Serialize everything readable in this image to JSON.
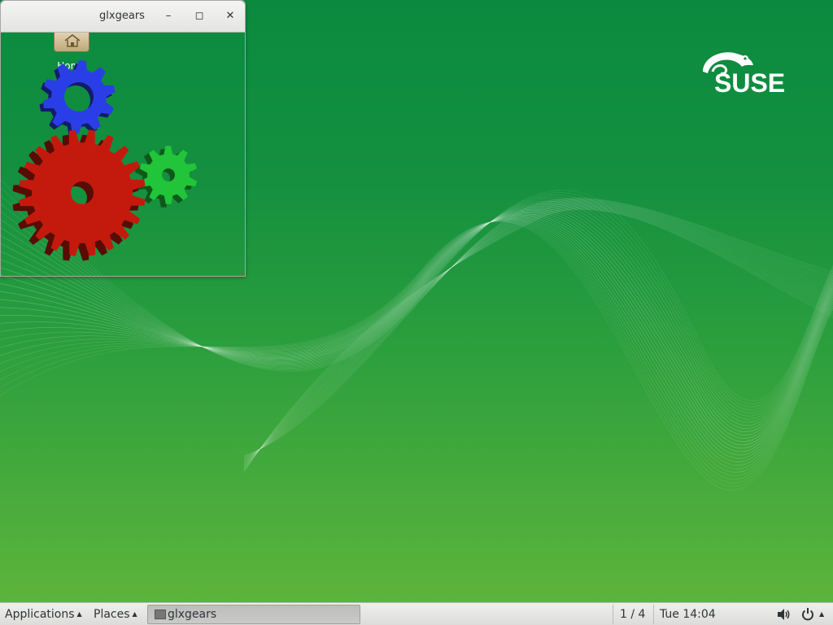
{
  "window": {
    "title": "glxgears",
    "minimize_glyph": "–",
    "maximize_glyph": "◻",
    "close_glyph": "✕"
  },
  "desktop": {
    "home_label": "Home",
    "logo": "SUSE"
  },
  "taskbar": {
    "applications_label": "Applications",
    "places_label": "Places",
    "menu_arrow": "▲",
    "window_button_label": "glxgears",
    "workspace": "1 / 4",
    "clock": "Tue 14:04",
    "system_arrow": "▲"
  },
  "colors": {
    "gear_red": "#c41a0e",
    "gear_green": "#22c43a",
    "gear_blue": "#2a3ee8",
    "desktop_top": "#0b8a3f",
    "desktop_bottom": "#5db43b"
  },
  "icons": {
    "home": "home-icon",
    "volume": "volume-icon",
    "power": "power-icon",
    "window": "window-icon"
  }
}
